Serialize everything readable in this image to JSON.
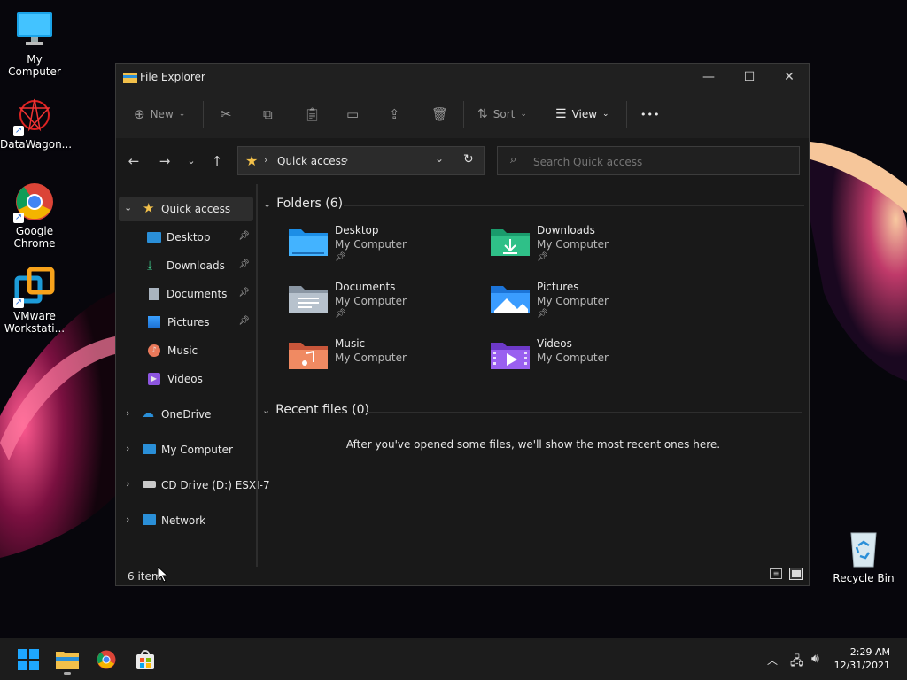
{
  "desktop": {
    "icons": [
      {
        "label": "My Computer",
        "icon": "monitor-icon"
      },
      {
        "label": "DataWagon...",
        "icon": "datawagon-logo-icon"
      },
      {
        "label": "Google Chrome",
        "icon": "chrome-icon"
      },
      {
        "label": "VMware Workstati...",
        "icon": "vmware-icon"
      }
    ],
    "recycle_bin": {
      "label": "Recycle Bin",
      "icon": "recycle-bin-icon"
    }
  },
  "window": {
    "title": "File Explorer",
    "toolbar": {
      "new_label": "New",
      "sort_label": "Sort",
      "view_label": "View",
      "more_label": "•••"
    },
    "address": {
      "path": "Quick access"
    },
    "search": {
      "placeholder": "Search Quick access"
    },
    "nav": {
      "quick_access": "Quick access",
      "quick_items": [
        {
          "label": "Desktop",
          "pinned": true
        },
        {
          "label": "Downloads",
          "pinned": true
        },
        {
          "label": "Documents",
          "pinned": true
        },
        {
          "label": "Pictures",
          "pinned": true
        },
        {
          "label": "Music",
          "pinned": false
        },
        {
          "label": "Videos",
          "pinned": false
        }
      ],
      "onedrive": "OneDrive",
      "my_computer": "My Computer",
      "cd_drive": "CD Drive (D:) ESXI-7",
      "network": "Network"
    },
    "content": {
      "folders_header": "Folders (6)",
      "folders": [
        {
          "name": "Desktop",
          "location": "My Computer",
          "pinned": true
        },
        {
          "name": "Downloads",
          "location": "My Computer",
          "pinned": true
        },
        {
          "name": "Documents",
          "location": "My Computer",
          "pinned": true
        },
        {
          "name": "Pictures",
          "location": "My Computer",
          "pinned": true
        },
        {
          "name": "Music",
          "location": "My Computer",
          "pinned": false
        },
        {
          "name": "Videos",
          "location": "My Computer",
          "pinned": false
        }
      ],
      "recent_header": "Recent files (0)",
      "recent_empty": "After you've opened some files, we'll show the most recent ones here."
    },
    "status": {
      "item_count": "6 item"
    }
  },
  "taskbar": {
    "time": "2:29 AM",
    "date": "12/31/2021"
  },
  "colors": {
    "accent": "#0078d4",
    "folder_yellow": "#f2c04a",
    "selection": "#2d2d2d"
  }
}
